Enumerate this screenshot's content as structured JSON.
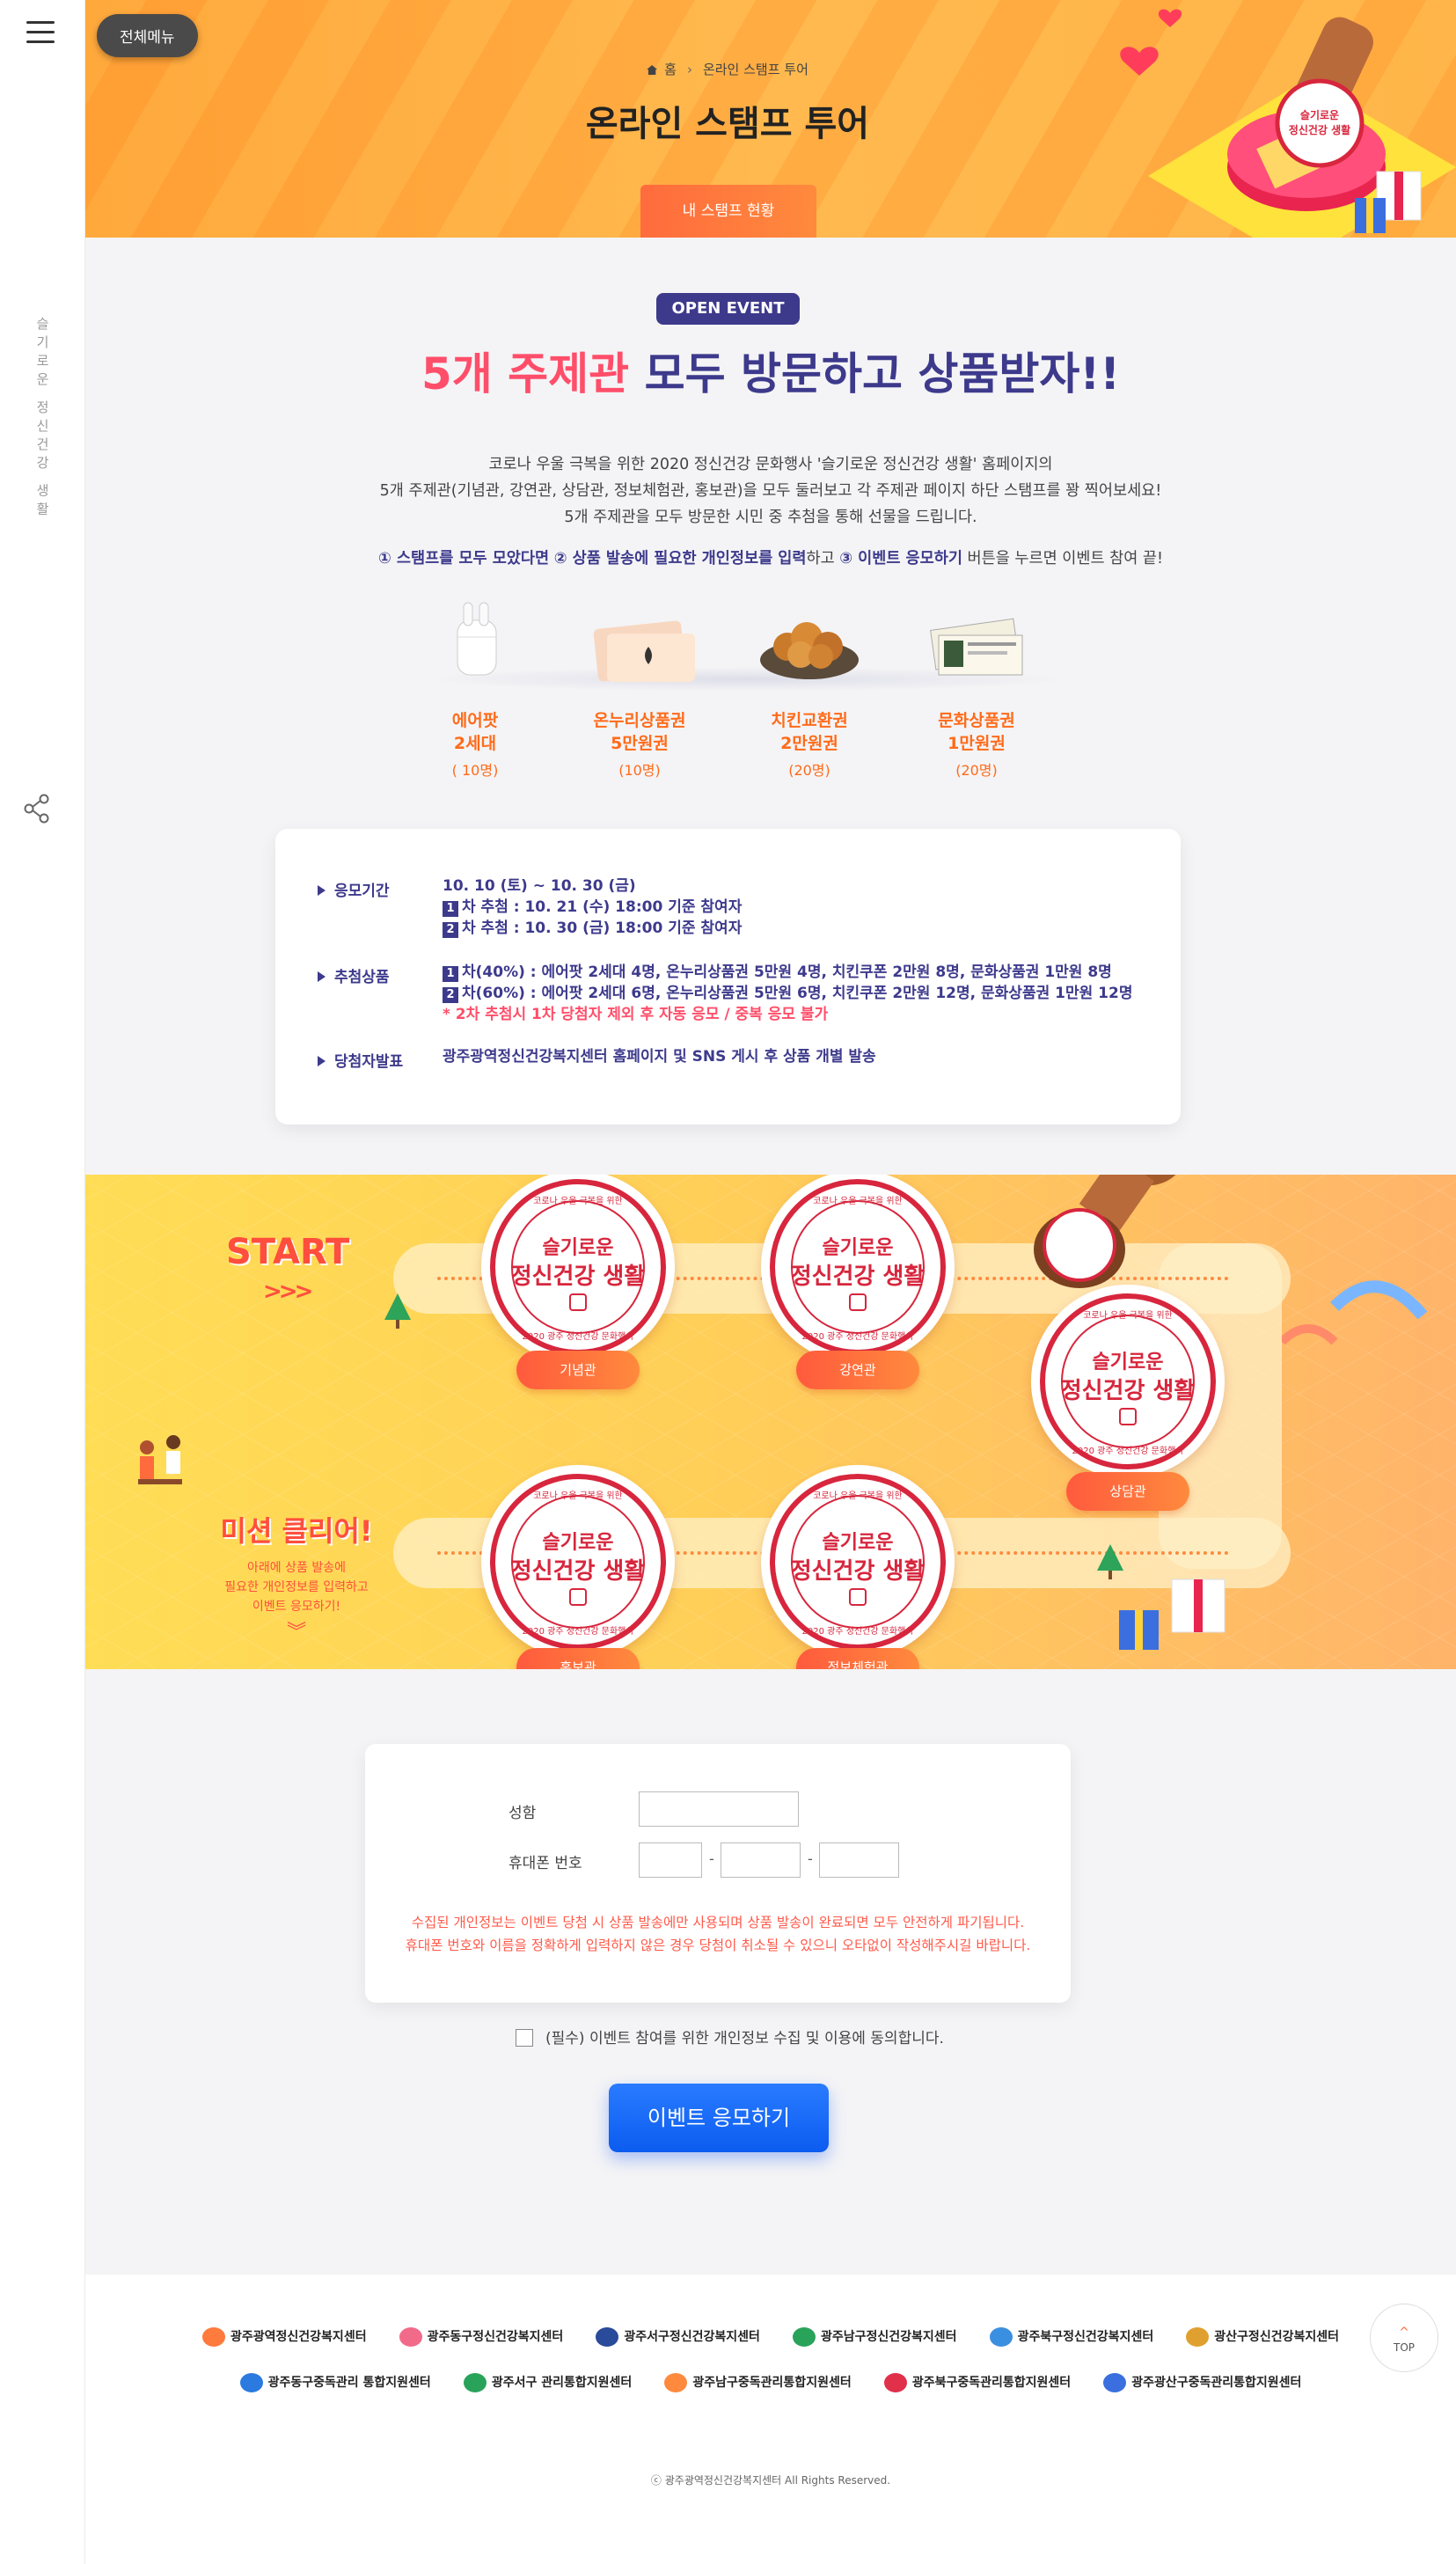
{
  "nav": {
    "menu_label": "전체메뉴",
    "vertical_text": "슬기로운 정신건강 생활"
  },
  "header": {
    "breadcrumb_home": "홈",
    "breadcrumb_current": "온라인 스탬프 투어",
    "title": "온라인 스탬프 투어",
    "stamp_status_button": "내 스탬프 현황"
  },
  "event": {
    "badge": "OPEN EVENT",
    "headline_highlight": "5개 주제관",
    "headline_rest": " 모두 방문하고 상품받자!!",
    "intro": [
      "코로나 우울 극복을 위한 2020 정신건강 문화행사 '슬기로운 정신건강 생활' 홈페이지의",
      "5개 주제관(기념관, 강연관, 상담관, 정보체험관, 홍보관)을 모두 둘러보고 각 주제관 페이지 하단 스탬프를 꽝 찍어보세요!",
      "5개 주제관을 모두 방문한 시민 중 추첨을 통해 선물을 드립니다."
    ],
    "steps": {
      "s1": "① 스탬프를 모두 모았다면",
      "s2": "② 상품 발송에 필요한 개인정보를 입력",
      "mid": "하고",
      "s3": "③ 이벤트 응모하기",
      "end": " 버튼을 누르면 이벤트 참여 끝!"
    },
    "prizes": [
      {
        "name1": "에어팟",
        "name2": "2세대",
        "count": "( 10명)"
      },
      {
        "name1": "온누리상품권",
        "name2": "5만원권",
        "count": "(10명)"
      },
      {
        "name1": "치킨교환권",
        "name2": "2만원권",
        "count": "(20명)"
      },
      {
        "name1": "문화상품권",
        "name2": "1만원권",
        "count": "(20명)"
      }
    ]
  },
  "info": {
    "period_label": "응모기간",
    "period_value": "10. 10 (토) ~ 10. 30 (금)",
    "draw1_num": "1",
    "draw1": "차 추첨 : 10. 21 (수) 18:00 기준 참여자",
    "draw2_num": "2",
    "draw2": "차 추첨 : 10. 30 (금) 18:00 기준 참여자",
    "prize_label": "추첨상품",
    "prize1_num": "1",
    "prize1": "차(40%) : 에어팟 2세대 4명, 온누리상품권 5만원 4명, 치킨쿠폰 2만원 8명, 문화상품권 1만원 8명",
    "prize2_num": "2",
    "prize2": "차(60%) : 에어팟 2세대 6명, 온누리상품권 5만원 6명, 치킨쿠폰 2만원 12명, 문화상품권 1만원 12명",
    "prize_warn": "* 2차 추첨시 1차 당첨자 제외 후 자동 응모 / 중복 응모 불가",
    "winner_label": "당첨자발표",
    "winner_value": "광주광역정신건강복지센터 홈페이지 및 SNS 게시 후 상품 개별 발송"
  },
  "map": {
    "start": "START",
    "start_arrow": ">>>",
    "mission_title": "미션 클리어!",
    "mission_desc": [
      "아래에 상품 발송에",
      "필요한 개인정보를 입력하고",
      "이벤트 응모하기!"
    ],
    "mission_chev": "︾",
    "stamp_line1": "슬기로운",
    "stamp_line2": "정신건강 생활",
    "stamp_top": "코로나 우울 극복을 위한",
    "stamp_bottom": "2020 광주 정신건강 문화행사",
    "places": [
      "기념관",
      "강연관",
      "상담관",
      "홍보관",
      "정보체험관"
    ]
  },
  "form": {
    "name_label": "성함",
    "phone_label": "휴대폰 번호",
    "name_value": "",
    "phone1": "",
    "phone2": "",
    "phone3": "",
    "dash": "-",
    "notice1": "수집된 개인정보는 이벤트 당첨 시 상품 발송에만 사용되며 상품 발송이 완료되면 모두 안전하게 파기됩니다.",
    "notice2": "휴대폰 번호와 이름을 정확하게 입력하지 않은 경우 당첨이 취소될 수 있으니 오타없이 작성해주시길 바랍니다."
  },
  "agree_text": "(필수) 이벤트 참여를 위한 개인정보 수집 및 이용에 동의합니다.",
  "submit_label": "이벤트 응모하기",
  "footer": {
    "row1": [
      "광주광역정신건강복지센터",
      "광주동구정신건강복지센터",
      "광주서구정신건강복지센터",
      "광주남구정신건강복지센터",
      "광주북구정신건강복지센터",
      "광산구정신건강복지센터"
    ],
    "row2": [
      "광주동구중독관리 통합지원센터",
      "광주서구 관리통합지원센터",
      "광주남구중독관리통합지원센터",
      "광주북구중독관리통합지원센터",
      "광주광산구중독관리통합지원센터"
    ],
    "copyright": "ⓒ 광주광역정신건강복지센터 All Rights Reserved.",
    "top_label": "TOP"
  },
  "colors": {
    "navy": "#3d3a8c",
    "pink": "#ff4e6a",
    "orange": "#ff6b1a",
    "stamp_red": "#d7263d",
    "submit_blue": "#0b5cf0"
  }
}
